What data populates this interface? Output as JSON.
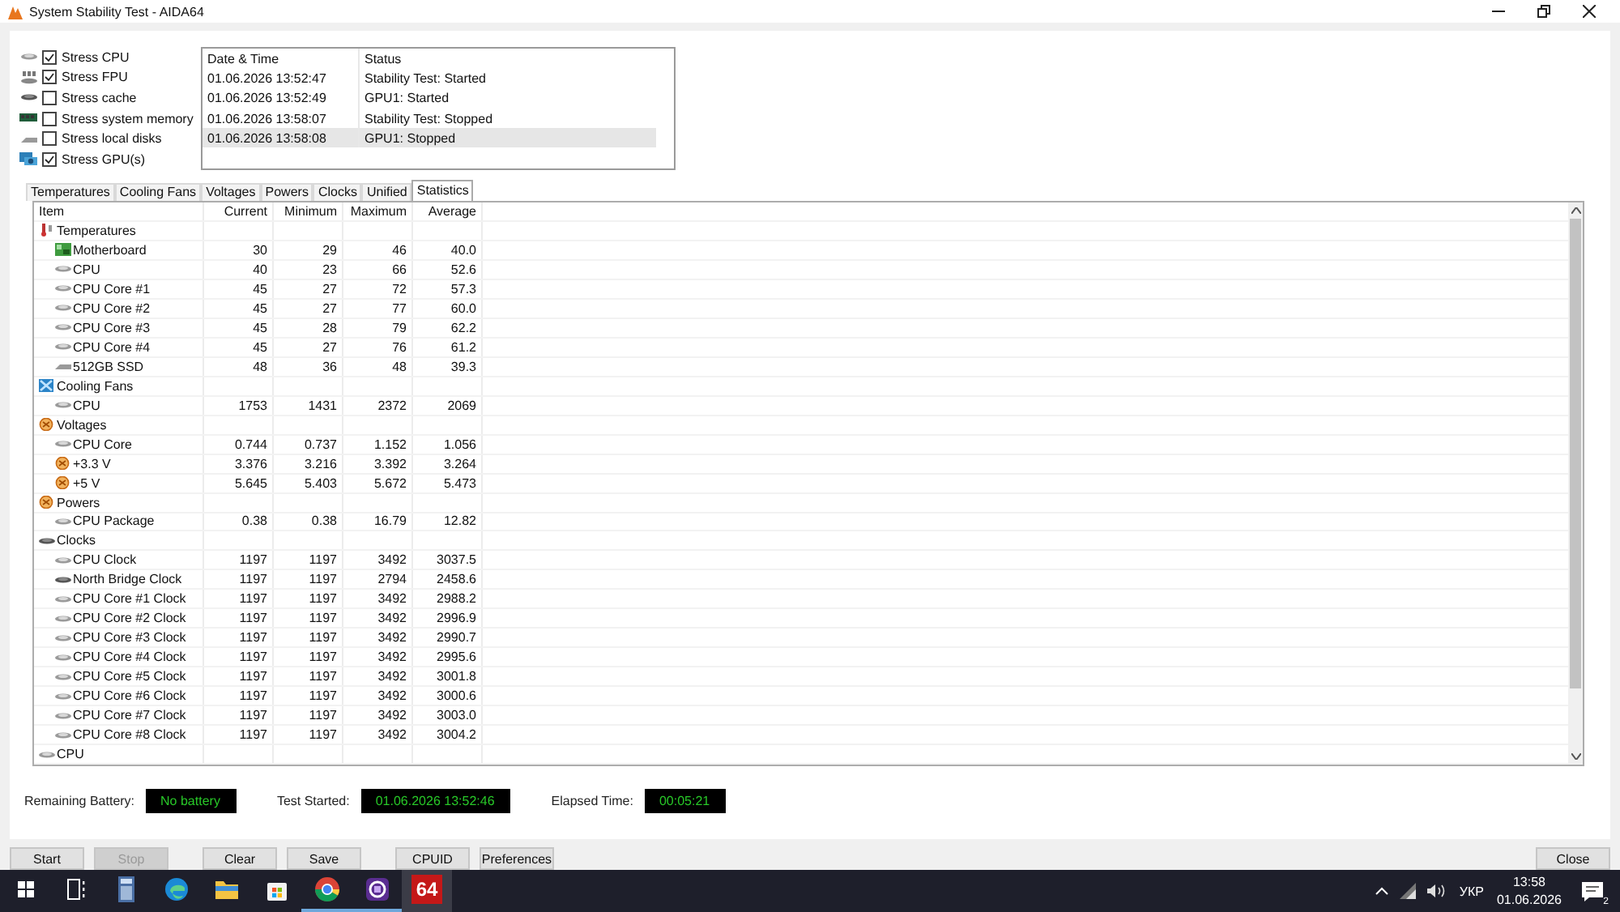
{
  "window": {
    "title": "System Stability Test - AIDA64"
  },
  "stress_options": [
    {
      "label": "Stress CPU",
      "checked": true,
      "kind": "chip"
    },
    {
      "label": "Stress FPU",
      "checked": true,
      "kind": "fpu"
    },
    {
      "label": "Stress cache",
      "checked": false,
      "kind": "dark-chip"
    },
    {
      "label": "Stress system memory",
      "checked": false,
      "kind": "memory"
    },
    {
      "label": "Stress local disks",
      "checked": false,
      "kind": "disk"
    },
    {
      "label": "Stress GPU(s)",
      "checked": true,
      "kind": "gpu"
    }
  ],
  "log": {
    "columns": [
      "Date & Time",
      "Status"
    ],
    "rows": [
      {
        "cells": [
          "01.06.2026 13:52:47",
          "Stability Test: Started"
        ],
        "selected": false
      },
      {
        "cells": [
          "01.06.2026 13:52:49",
          "GPU1: Started"
        ],
        "selected": false
      },
      {
        "cells": [
          "01.06.2026 13:58:07",
          "Stability Test: Stopped"
        ],
        "selected": false
      },
      {
        "cells": [
          "01.06.2026 13:58:08",
          "GPU1: Stopped"
        ],
        "selected": true
      }
    ]
  },
  "tabs": [
    {
      "label": "Temperatures",
      "selected": false
    },
    {
      "label": "Cooling Fans",
      "selected": false
    },
    {
      "label": "Voltages",
      "selected": false
    },
    {
      "label": "Powers",
      "selected": false
    },
    {
      "label": "Clocks",
      "selected": false
    },
    {
      "label": "Unified",
      "selected": false
    },
    {
      "label": "Statistics",
      "selected": true
    }
  ],
  "statistics": {
    "columns": [
      "Item",
      "Current",
      "Minimum",
      "Maximum",
      "Average"
    ],
    "rows": [
      {
        "item": "Temperatures",
        "kind": "thermometer",
        "children": [
          {
            "item": "Motherboard",
            "kind": "board",
            "values": [
              "30",
              "29",
              "46",
              "40.0"
            ]
          },
          {
            "item": "CPU",
            "kind": "chip",
            "values": [
              "40",
              "23",
              "66",
              "52.6"
            ]
          },
          {
            "item": "CPU Core #1",
            "kind": "chip",
            "values": [
              "45",
              "27",
              "72",
              "57.3"
            ]
          },
          {
            "item": "CPU Core #2",
            "kind": "chip",
            "values": [
              "45",
              "27",
              "77",
              "60.0"
            ]
          },
          {
            "item": "CPU Core #3",
            "kind": "chip",
            "values": [
              "45",
              "28",
              "79",
              "62.2"
            ]
          },
          {
            "item": "CPU Core #4",
            "kind": "chip",
            "values": [
              "45",
              "27",
              "76",
              "61.2"
            ]
          },
          {
            "item": "512GB SSD",
            "kind": "disk",
            "values": [
              "48",
              "36",
              "48",
              "39.3"
            ]
          }
        ]
      },
      {
        "item": "Cooling Fans",
        "kind": "fan",
        "children": [
          {
            "item": "CPU",
            "kind": "chip",
            "values": [
              "1753",
              "1431",
              "2372",
              "2069"
            ]
          }
        ]
      },
      {
        "item": "Voltages",
        "kind": "dial",
        "children": [
          {
            "item": "CPU Core",
            "kind": "chip",
            "values": [
              "0.744",
              "0.737",
              "1.152",
              "1.056"
            ]
          },
          {
            "item": "+3.3 V",
            "kind": "dial",
            "values": [
              "3.376",
              "3.216",
              "3.392",
              "3.264"
            ]
          },
          {
            "item": "+5 V",
            "kind": "dial",
            "values": [
              "5.645",
              "5.403",
              "5.672",
              "5.473"
            ]
          }
        ]
      },
      {
        "item": "Powers",
        "kind": "dial",
        "children": [
          {
            "item": "CPU Package",
            "kind": "chip",
            "values": [
              "0.38",
              "0.38",
              "16.79",
              "12.82"
            ]
          }
        ]
      },
      {
        "item": "Clocks",
        "kind": "dark-chip",
        "children": [
          {
            "item": "CPU Clock",
            "kind": "chip",
            "values": [
              "1197",
              "1197",
              "3492",
              "3037.5"
            ]
          },
          {
            "item": "North Bridge Clock",
            "kind": "dark-chip",
            "values": [
              "1197",
              "1197",
              "2794",
              "2458.6"
            ]
          },
          {
            "item": "CPU Core #1 Clock",
            "kind": "chip",
            "values": [
              "1197",
              "1197",
              "3492",
              "2988.2"
            ]
          },
          {
            "item": "CPU Core #2 Clock",
            "kind": "chip",
            "values": [
              "1197",
              "1197",
              "3492",
              "2996.9"
            ]
          },
          {
            "item": "CPU Core #3 Clock",
            "kind": "chip",
            "values": [
              "1197",
              "1197",
              "3492",
              "2990.7"
            ]
          },
          {
            "item": "CPU Core #4 Clock",
            "kind": "chip",
            "values": [
              "1197",
              "1197",
              "3492",
              "2995.6"
            ]
          },
          {
            "item": "CPU Core #5 Clock",
            "kind": "chip",
            "values": [
              "1197",
              "1197",
              "3492",
              "3001.8"
            ]
          },
          {
            "item": "CPU Core #6 Clock",
            "kind": "chip",
            "values": [
              "1197",
              "1197",
              "3492",
              "3000.6"
            ]
          },
          {
            "item": "CPU Core #7 Clock",
            "kind": "chip",
            "values": [
              "1197",
              "1197",
              "3492",
              "3003.0"
            ]
          },
          {
            "item": "CPU Core #8 Clock",
            "kind": "chip",
            "values": [
              "1197",
              "1197",
              "3492",
              "3004.2"
            ]
          }
        ]
      },
      {
        "item": "CPU",
        "kind": "chip"
      }
    ]
  },
  "status": [
    {
      "label": "Remaining Battery:",
      "value": "No battery"
    },
    {
      "label": "Test Started:",
      "value": "01.06.2026 13:52:46"
    },
    {
      "label": "Elapsed Time:",
      "value": "00:05:21"
    }
  ],
  "buttons": [
    {
      "label": "Start",
      "disabled": false
    },
    {
      "label": "Stop",
      "disabled": true
    },
    {
      "label": "Clear",
      "disabled": false
    },
    {
      "label": "Save",
      "disabled": false
    },
    {
      "label": "CPUID",
      "disabled": false
    },
    {
      "label": "Preferences",
      "disabled": false
    }
  ],
  "close_button": "Close",
  "taskbar": {
    "apps": [
      {
        "kind": "start",
        "running": false,
        "selected": false
      },
      {
        "kind": "taskview",
        "running": false,
        "selected": false
      },
      {
        "kind": "calculator",
        "running": false,
        "selected": false
      },
      {
        "kind": "edge",
        "running": false,
        "selected": false
      },
      {
        "kind": "folder",
        "running": false,
        "selected": false
      },
      {
        "kind": "store",
        "running": false,
        "selected": false
      },
      {
        "kind": "chrome",
        "running": true,
        "selected": false
      },
      {
        "kind": "purple",
        "running": true,
        "selected": false
      },
      {
        "kind": "label",
        "label": "64",
        "running": false,
        "selected": true
      }
    ],
    "language": "УКР",
    "time": "13:58",
    "date": "01.06.2026",
    "notifications": "2"
  }
}
